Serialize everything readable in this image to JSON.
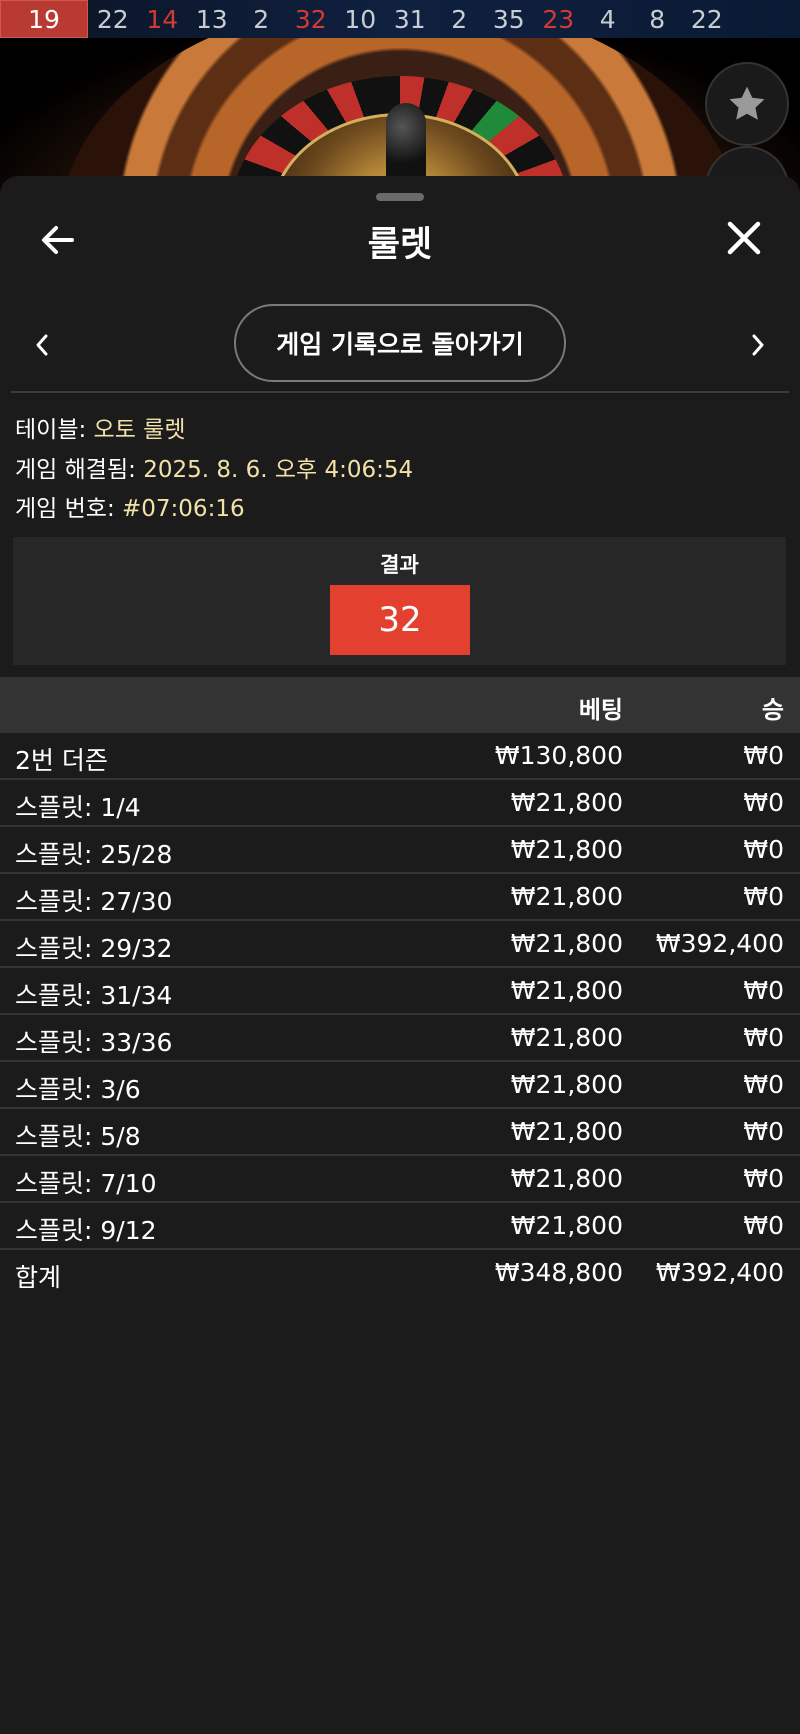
{
  "history": {
    "numbers": [
      {
        "n": "19",
        "color": "red"
      },
      {
        "n": "22",
        "color": "black"
      },
      {
        "n": "14",
        "color": "red"
      },
      {
        "n": "13",
        "color": "black"
      },
      {
        "n": "2",
        "color": "black"
      },
      {
        "n": "32",
        "color": "red"
      },
      {
        "n": "10",
        "color": "black"
      },
      {
        "n": "31",
        "color": "black"
      },
      {
        "n": "2",
        "color": "black"
      },
      {
        "n": "35",
        "color": "black"
      },
      {
        "n": "23",
        "color": "red"
      },
      {
        "n": "4",
        "color": "black"
      },
      {
        "n": "8",
        "color": "black"
      },
      {
        "n": "22",
        "color": "black"
      }
    ]
  },
  "header": {
    "title": "룰렛",
    "back_icon": "arrow-left-icon",
    "close_icon": "close-icon"
  },
  "navigation": {
    "back_to_history_label": "게임 기록으로 돌아가기"
  },
  "info": {
    "table_label": "테이블:",
    "table_value": "오토 룰렛",
    "resolved_label": "게임 해결됨:",
    "resolved_value": "2025. 8. 6. 오후 4:06:54",
    "game_number_label": "게임 번호:",
    "game_number_value": "#07:06:16"
  },
  "result": {
    "label": "결과",
    "number": "32",
    "color": "#e4402f"
  },
  "bets_table": {
    "headers": {
      "bet": "베팅",
      "win": "승"
    },
    "rows": [
      {
        "label": "2번 더즌",
        "bet": "₩130,800",
        "win": "₩0"
      },
      {
        "label": "스플릿: 1/4",
        "bet": "₩21,800",
        "win": "₩0"
      },
      {
        "label": "스플릿: 25/28",
        "bet": "₩21,800",
        "win": "₩0"
      },
      {
        "label": "스플릿: 27/30",
        "bet": "₩21,800",
        "win": "₩0"
      },
      {
        "label": "스플릿: 29/32",
        "bet": "₩21,800",
        "win": "₩392,400"
      },
      {
        "label": "스플릿: 31/34",
        "bet": "₩21,800",
        "win": "₩0"
      },
      {
        "label": "스플릿: 33/36",
        "bet": "₩21,800",
        "win": "₩0"
      },
      {
        "label": "스플릿: 3/6",
        "bet": "₩21,800",
        "win": "₩0"
      },
      {
        "label": "스플릿: 5/8",
        "bet": "₩21,800",
        "win": "₩0"
      },
      {
        "label": "스플릿: 7/10",
        "bet": "₩21,800",
        "win": "₩0"
      },
      {
        "label": "스플릿: 9/12",
        "bet": "₩21,800",
        "win": "₩0"
      }
    ],
    "total": {
      "label": "합계",
      "bet": "₩348,800",
      "win": "₩392,400"
    }
  }
}
